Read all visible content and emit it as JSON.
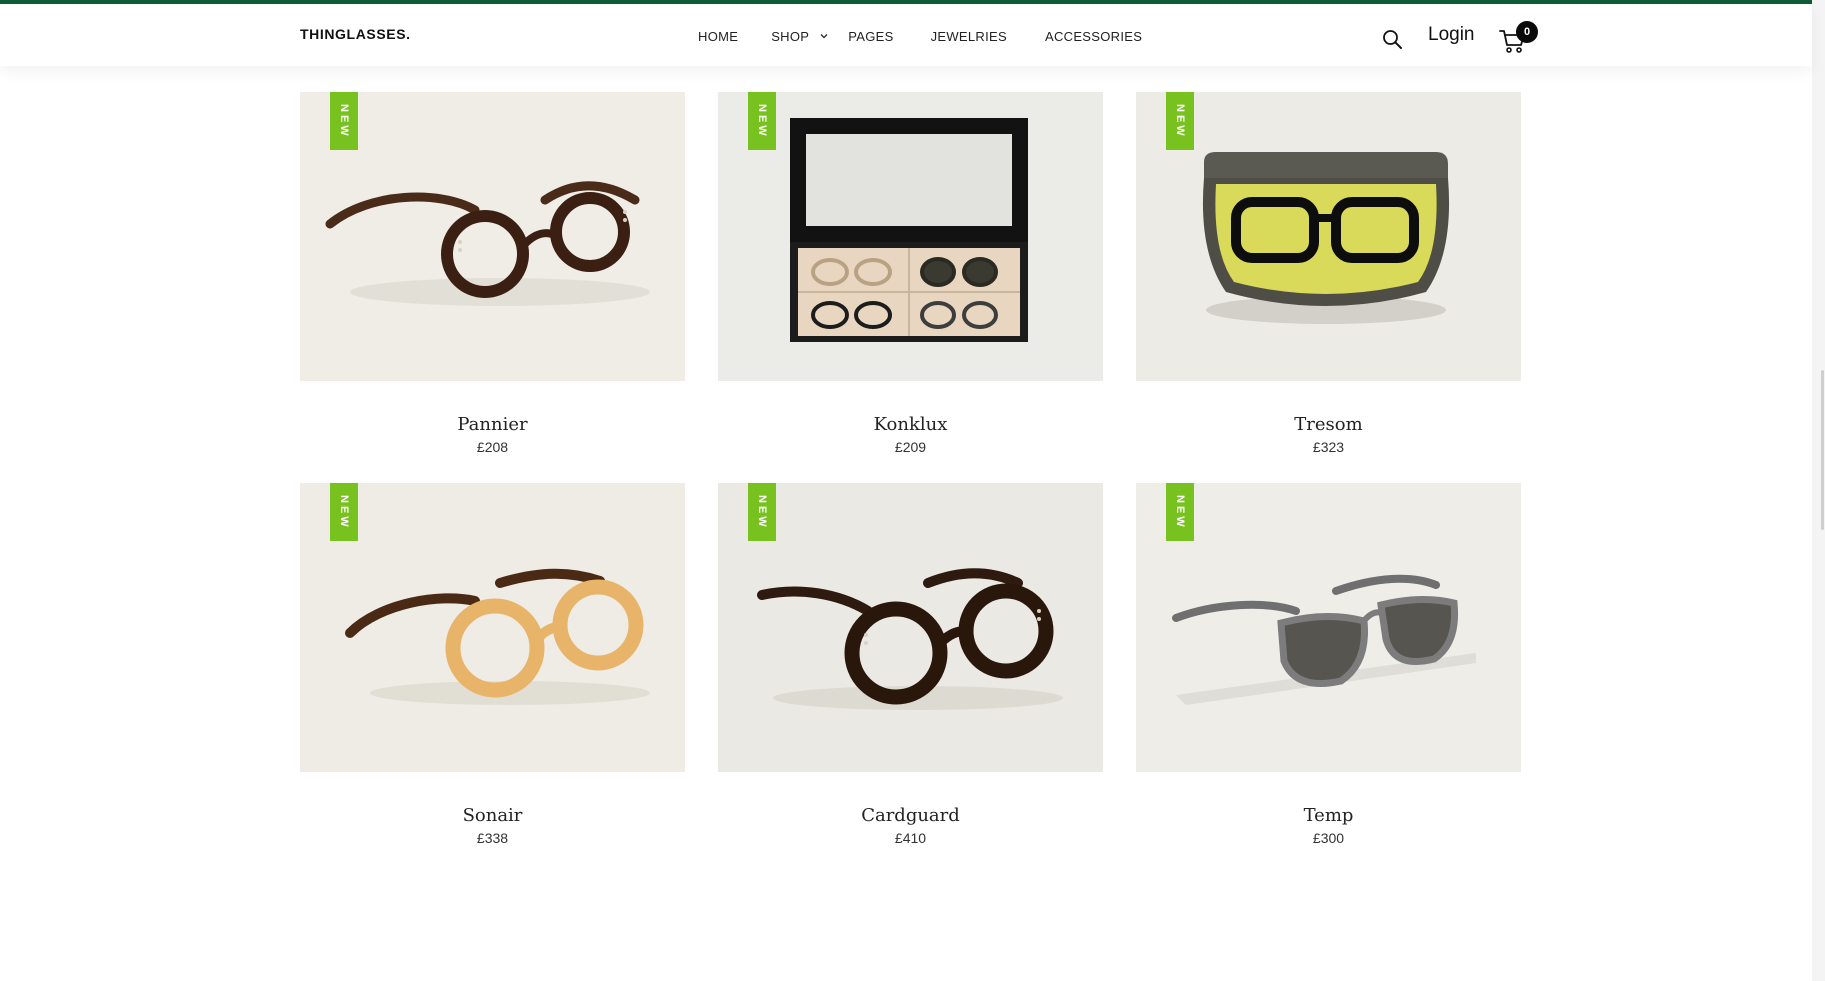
{
  "brand": {
    "logo": "THINGLASSES.",
    "accent_color": "#0f5a37",
    "badge_color": "#77c21f"
  },
  "nav": {
    "items": [
      {
        "label": "HOME"
      },
      {
        "label": "SHOP"
      },
      {
        "label": "PAGES"
      },
      {
        "label": "JEWELRIES"
      },
      {
        "label": "ACCESSORIES"
      }
    ],
    "login_label": "Login",
    "cart_count": "0",
    "icons": [
      "search-icon",
      "cart-icon",
      "chevron-down-icon"
    ]
  },
  "products": [
    {
      "name": "Pannier",
      "price": "£208",
      "badge": "NEW"
    },
    {
      "name": "Konklux",
      "price": "£209",
      "badge": "NEW"
    },
    {
      "name": "Tresom",
      "price": "£323",
      "badge": "NEW"
    },
    {
      "name": "Sonair",
      "price": "£338",
      "badge": "NEW"
    },
    {
      "name": "Cardguard",
      "price": "£410",
      "badge": "NEW"
    },
    {
      "name": "Temp",
      "price": "£300",
      "badge": "NEW"
    }
  ]
}
